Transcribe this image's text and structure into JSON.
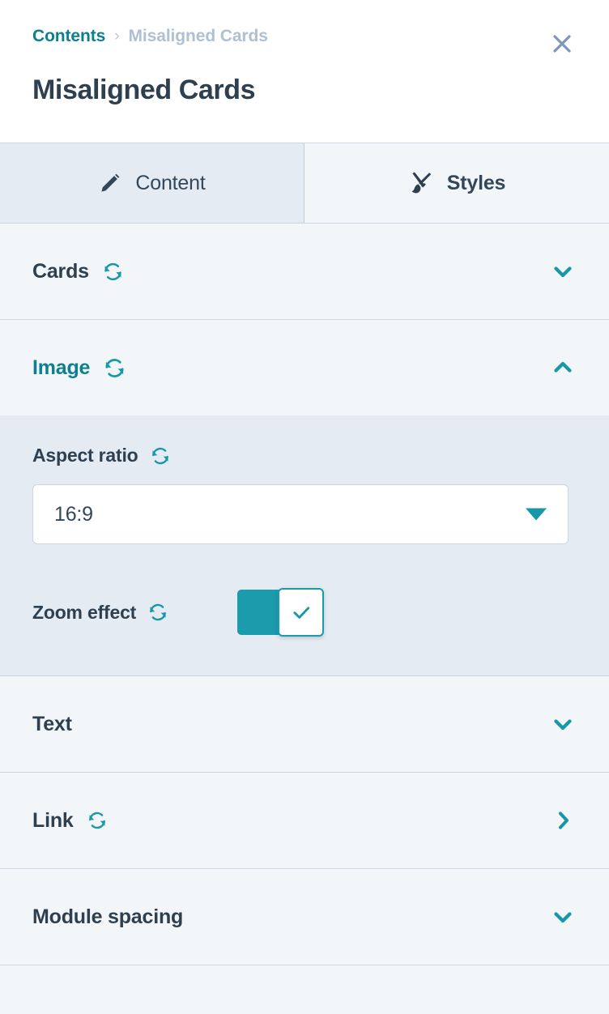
{
  "colors": {
    "accent": "#0D7F8F",
    "toggle_on": "#1B9BAC",
    "caret": "#1698A9",
    "text_dark": "#2E3F50",
    "text_muted": "#AFC0D2",
    "border": "#CBD6E2",
    "bg_header": "#F2F6F9",
    "bg_body": "#E5EBF2",
    "white": "#FFFFFF"
  },
  "header": {
    "breadcrumb": {
      "root_label": "Contents",
      "separator": "›",
      "current_label": "Misaligned Cards"
    },
    "title": "Misaligned Cards",
    "close_icon": "close-icon"
  },
  "tabs": [
    {
      "id": "content",
      "label": "Content",
      "icon": "pencil-icon",
      "active": true
    },
    {
      "id": "styles",
      "label": "Styles",
      "icon": "paintbrush-icon",
      "active": false
    }
  ],
  "sections": [
    {
      "id": "cards",
      "title": "Cards",
      "accent": false,
      "has_reset_icon": true,
      "reset_icon": "refresh-icon",
      "chevron": "chevron-down-icon",
      "expanded": false
    },
    {
      "id": "image",
      "title": "Image",
      "accent": true,
      "has_reset_icon": true,
      "reset_icon": "refresh-icon",
      "chevron": "chevron-up-icon",
      "expanded": true
    },
    {
      "id": "text",
      "title": "Text",
      "accent": false,
      "has_reset_icon": false,
      "reset_icon": "",
      "chevron": "chevron-down-icon",
      "expanded": false
    },
    {
      "id": "link",
      "title": "Link",
      "accent": false,
      "has_reset_icon": true,
      "reset_icon": "refresh-icon",
      "chevron": "chevron-right-icon",
      "expanded": false
    },
    {
      "id": "module-spacing",
      "title": "Module spacing",
      "accent": false,
      "has_reset_icon": false,
      "reset_icon": "",
      "chevron": "chevron-down-icon",
      "expanded": false
    }
  ],
  "image_section": {
    "aspect_ratio": {
      "label": "Aspect ratio",
      "reset_icon": "refresh-icon",
      "value": "16:9",
      "caret_icon": "caret-down-icon"
    },
    "zoom_effect": {
      "label": "Zoom effect",
      "reset_icon": "refresh-icon",
      "checked": true,
      "check_icon": "check-icon"
    }
  }
}
